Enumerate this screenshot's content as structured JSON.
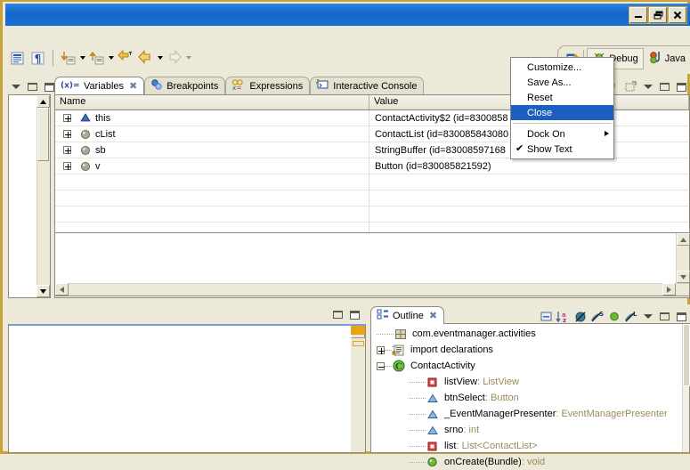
{
  "window": {
    "title": "",
    "buttons": {
      "minimize": "minimize-button",
      "restore": "restore-button",
      "close": "close-button"
    }
  },
  "colors": {
    "titlebar_blue": "#1d6fd0",
    "frame_gold": "#c8a33a",
    "menu_highlight": "#1d5fbe",
    "panel_bg": "#ece9d8",
    "type_text": "#9a8a5a"
  },
  "toolbar": {
    "icons": [
      {
        "name": "show-whitespace-icon"
      },
      {
        "name": "paragraph-marks-icon"
      },
      {
        "name": "step-into-icon"
      },
      {
        "name": "step-over-icon"
      },
      {
        "name": "step-return-icon"
      },
      {
        "name": "drop-to-frame-icon"
      },
      {
        "name": "back-icon"
      },
      {
        "name": "forward-icon"
      }
    ]
  },
  "perspective_bar": {
    "open_perspective_label": "",
    "items": [
      {
        "label": "Debug",
        "selected": true,
        "icon": "debug-perspective-icon"
      },
      {
        "label": "Java",
        "selected": false,
        "icon": "java-perspective-icon"
      }
    ]
  },
  "context_menu": {
    "items": [
      {
        "label": "Customize...",
        "selected": false,
        "type": "item"
      },
      {
        "label": "Save As...",
        "selected": false,
        "type": "item"
      },
      {
        "label": "Reset",
        "selected": false,
        "type": "item"
      },
      {
        "label": "Close",
        "selected": true,
        "type": "item"
      },
      {
        "type": "separator"
      },
      {
        "label": "Dock On",
        "selected": false,
        "type": "submenu"
      },
      {
        "label": "Show Text",
        "selected": false,
        "type": "check",
        "checked": true,
        "check_glyph": "✔"
      }
    ]
  },
  "debug_view_group": {
    "tabs": [
      {
        "label": "Variables",
        "active": true,
        "icon": "variables-icon",
        "close_glyph": "✖"
      },
      {
        "label": "Breakpoints",
        "active": false,
        "icon": "breakpoints-icon"
      },
      {
        "label": "Expressions",
        "active": false,
        "icon": "expressions-icon"
      },
      {
        "label": "Interactive Console",
        "active": false,
        "icon": "console-icon"
      }
    ],
    "toolbar_icons": [
      {
        "name": "show-logical-structure-icon"
      },
      {
        "name": "collapse-all-icon"
      },
      {
        "name": "layout-menu-icon"
      },
      {
        "name": "new-detail-pane-icon"
      },
      {
        "name": "view-menu-icon"
      },
      {
        "name": "minimize-icon"
      },
      {
        "name": "maximize-icon"
      }
    ]
  },
  "variables_table": {
    "columns": [
      "Name",
      "Value"
    ],
    "rows": [
      {
        "name": "this",
        "value": "ContactActivity$2  (id=8300858",
        "icon": "this-reference-icon",
        "expandable": true
      },
      {
        "name": "cList",
        "value": "ContactList  (id=830085843080",
        "icon": "local-variable-icon",
        "expandable": true
      },
      {
        "name": "sb",
        "value": "StringBuffer  (id=83008597168",
        "icon": "local-variable-icon",
        "expandable": true
      },
      {
        "name": "v",
        "value": "Button  (id=830085821592)",
        "icon": "local-variable-icon",
        "expandable": true
      }
    ],
    "empty_rows": 6
  },
  "editor_panel": {
    "toolbar_icons": [
      {
        "name": "minimize-icon"
      },
      {
        "name": "maximize-icon"
      }
    ]
  },
  "outline_view": {
    "tab": {
      "label": "Outline",
      "icon": "outline-icon",
      "close_glyph": "✖"
    },
    "toolbar_icons": [
      {
        "name": "collapse-all-icon"
      },
      {
        "name": "sort-alphabetically-icon"
      },
      {
        "name": "hide-non-public-members-icon"
      },
      {
        "name": "hide-static-fields-icon"
      },
      {
        "name": "hide-fields-icon"
      },
      {
        "name": "hide-local-types-icon"
      },
      {
        "name": "view-menu-icon"
      },
      {
        "name": "minimize-icon"
      },
      {
        "name": "maximize-icon"
      }
    ],
    "tree": [
      {
        "label": "com.eventmanager.activities",
        "type": "",
        "icon": "package-icon",
        "toggle": "none",
        "indent": 0
      },
      {
        "label": "import declarations",
        "type": "",
        "icon": "imports-icon",
        "toggle": "plus",
        "indent": 0
      },
      {
        "label": "ContactActivity",
        "type": "",
        "icon": "class-icon",
        "toggle": "minus",
        "indent": 0
      },
      {
        "label": "listView",
        "type": "ListView",
        "icon": "field-private-icon",
        "toggle": "none",
        "indent": 1
      },
      {
        "label": "btnSelect",
        "type": "Button",
        "icon": "field-default-icon",
        "toggle": "none",
        "indent": 1
      },
      {
        "label": "_EventManagerPresenter",
        "type": "EventManagerPresenter",
        "icon": "field-default-icon",
        "toggle": "none",
        "indent": 1
      },
      {
        "label": "srno",
        "type": "int",
        "icon": "field-default-icon",
        "toggle": "none",
        "indent": 1
      },
      {
        "label": "list",
        "type": "List<ContactList>",
        "icon": "field-private-icon",
        "toggle": "none",
        "indent": 1
      },
      {
        "label": "onCreate(Bundle)",
        "type": "void",
        "icon": "method-public-icon",
        "toggle": "none",
        "indent": 1
      }
    ]
  }
}
